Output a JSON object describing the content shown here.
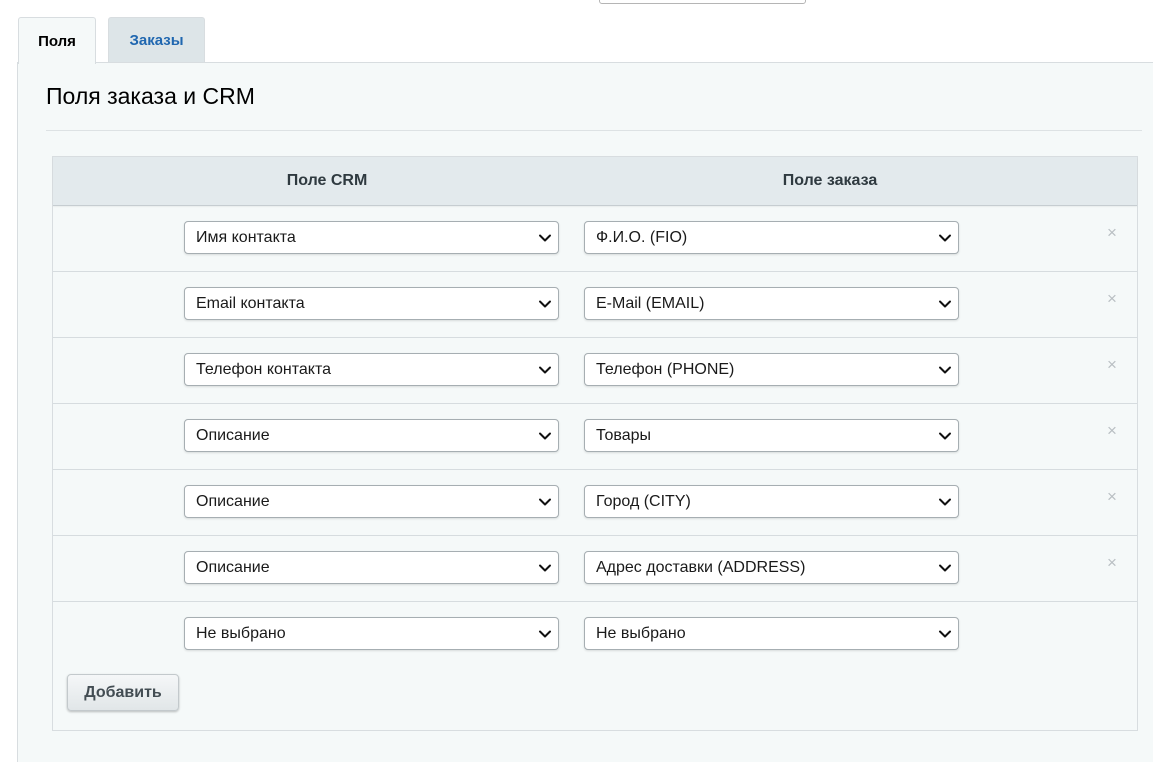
{
  "tabs": [
    {
      "label": "Поля",
      "active": true
    },
    {
      "label": "Заказы",
      "active": false
    }
  ],
  "section_title": "Поля заказа и CRM",
  "columns": {
    "crm": "Поле CRM",
    "order": "Поле заказа"
  },
  "rows": [
    {
      "crm": "Имя контакта",
      "order": "Ф.И.О. (FIO)",
      "removable": true
    },
    {
      "crm": "Email контакта",
      "order": "E-Mail (EMAIL)",
      "removable": true
    },
    {
      "crm": "Телефон контакта",
      "order": "Телефон (PHONE)",
      "removable": true
    },
    {
      "crm": "Описание",
      "order": "Товары",
      "removable": true
    },
    {
      "crm": "Описание",
      "order": "Город (CITY)",
      "removable": true
    },
    {
      "crm": "Описание",
      "order": "Адрес доставки (ADDRESS)",
      "removable": true
    },
    {
      "crm": "Не выбрано",
      "order": "Не выбрано",
      "removable": false
    }
  ],
  "add_button": "Добавить",
  "remove_glyph": "×",
  "icons": {
    "dropdown": "chevron-down-icon",
    "remove": "close-icon"
  },
  "colors": {
    "tab_link": "#2067b0",
    "panel_bg": "#f5f9f9",
    "header_bg": "#e3eaed"
  }
}
